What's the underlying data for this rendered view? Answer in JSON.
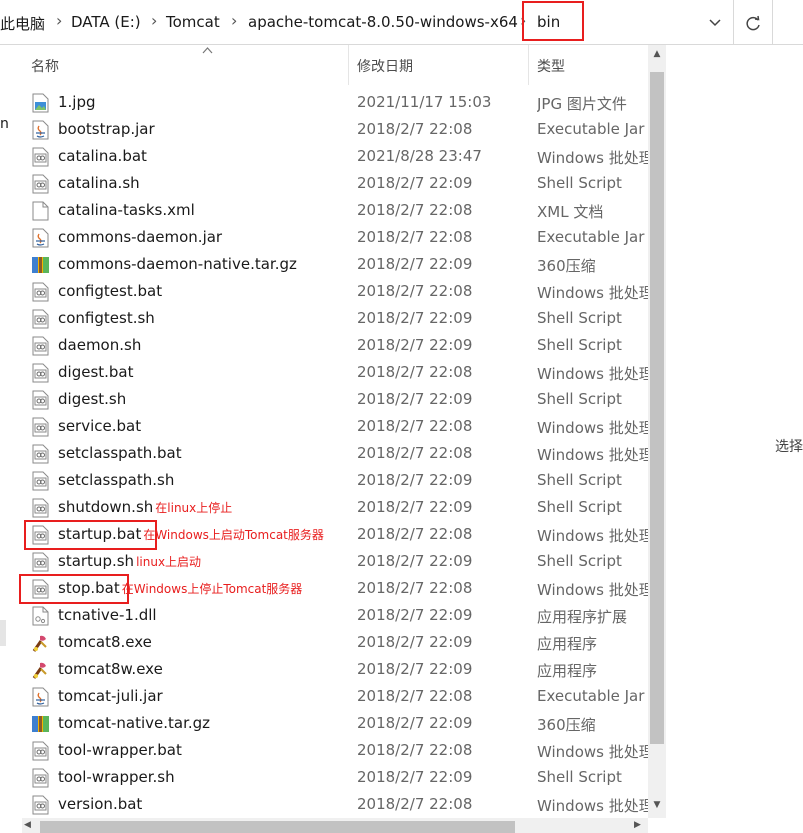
{
  "address": {
    "crumbs": [
      "此电脑",
      "DATA (E:)",
      "Tomcat",
      "apache-tomcat-8.0.50-windows-x64",
      "bin"
    ],
    "separator": "›",
    "dropdown_icon": "chevron-down-icon",
    "refresh_icon": "refresh-icon"
  },
  "left_nav_char": "n",
  "columns": {
    "name": "名称",
    "date": "修改日期",
    "type": "类型"
  },
  "details_pane_text": "选择",
  "files": [
    {
      "name": "1.jpg",
      "date": "2021/11/17 15:03",
      "type": "JPG 图片文件",
      "icon": "jpg"
    },
    {
      "name": "bootstrap.jar",
      "date": "2018/2/7 22:08",
      "type": "Executable Jar File",
      "icon": "jar"
    },
    {
      "name": "catalina.bat",
      "date": "2021/8/28 23:47",
      "type": "Windows 批处理文件",
      "icon": "bat"
    },
    {
      "name": "catalina.sh",
      "date": "2018/2/7 22:09",
      "type": "Shell Script",
      "icon": "bat"
    },
    {
      "name": "catalina-tasks.xml",
      "date": "2018/2/7 22:08",
      "type": "XML 文档",
      "icon": "doc"
    },
    {
      "name": "commons-daemon.jar",
      "date": "2018/2/7 22:08",
      "type": "Executable Jar File",
      "icon": "jar"
    },
    {
      "name": "commons-daemon-native.tar.gz",
      "date": "2018/2/7 22:09",
      "type": "360压缩",
      "icon": "zip"
    },
    {
      "name": "configtest.bat",
      "date": "2018/2/7 22:08",
      "type": "Windows 批处理文件",
      "icon": "bat"
    },
    {
      "name": "configtest.sh",
      "date": "2018/2/7 22:09",
      "type": "Shell Script",
      "icon": "bat"
    },
    {
      "name": "daemon.sh",
      "date": "2018/2/7 22:09",
      "type": "Shell Script",
      "icon": "bat"
    },
    {
      "name": "digest.bat",
      "date": "2018/2/7 22:08",
      "type": "Windows 批处理文件",
      "icon": "bat"
    },
    {
      "name": "digest.sh",
      "date": "2018/2/7 22:09",
      "type": "Shell Script",
      "icon": "bat"
    },
    {
      "name": "service.bat",
      "date": "2018/2/7 22:08",
      "type": "Windows 批处理文件",
      "icon": "bat"
    },
    {
      "name": "setclasspath.bat",
      "date": "2018/2/7 22:08",
      "type": "Windows 批处理文件",
      "icon": "bat"
    },
    {
      "name": "setclasspath.sh",
      "date": "2018/2/7 22:09",
      "type": "Shell Script",
      "icon": "bat"
    },
    {
      "name": "shutdown.sh",
      "date": "2018/2/7 22:09",
      "type": "Shell Script",
      "icon": "bat",
      "annotation": "在linux上停止"
    },
    {
      "name": "startup.bat",
      "date": "2018/2/7 22:08",
      "type": "Windows 批处理文件",
      "icon": "bat",
      "annotation": "在Windows上启动Tomcat服务器",
      "highlight": true
    },
    {
      "name": "startup.sh",
      "date": "2018/2/7 22:09",
      "type": "Shell Script",
      "icon": "bat",
      "annotation": "linux上启动"
    },
    {
      "name": "stop.bat",
      "date": "2018/2/7 22:08",
      "type": "Windows 批处理文件",
      "icon": "bat",
      "annotation": "在Windows上停止Tomcat服务器",
      "highlight": true
    },
    {
      "name": "tcnative-1.dll",
      "date": "2018/2/7 22:09",
      "type": "应用程序扩展",
      "icon": "dll"
    },
    {
      "name": "tomcat8.exe",
      "date": "2018/2/7 22:09",
      "type": "应用程序",
      "icon": "exe"
    },
    {
      "name": "tomcat8w.exe",
      "date": "2018/2/7 22:09",
      "type": "应用程序",
      "icon": "exe"
    },
    {
      "name": "tomcat-juli.jar",
      "date": "2018/2/7 22:08",
      "type": "Executable Jar File",
      "icon": "jar"
    },
    {
      "name": "tomcat-native.tar.gz",
      "date": "2018/2/7 22:09",
      "type": "360压缩",
      "icon": "zip"
    },
    {
      "name": "tool-wrapper.bat",
      "date": "2018/2/7 22:08",
      "type": "Windows 批处理文件",
      "icon": "bat"
    },
    {
      "name": "tool-wrapper.sh",
      "date": "2018/2/7 22:09",
      "type": "Shell Script",
      "icon": "bat"
    },
    {
      "name": "version.bat",
      "date": "2018/2/7 22:08",
      "type": "Windows 批处理文件",
      "icon": "bat"
    }
  ],
  "colors": {
    "annotation": "#e81e1e",
    "highlight_border": "#e81e1e"
  }
}
